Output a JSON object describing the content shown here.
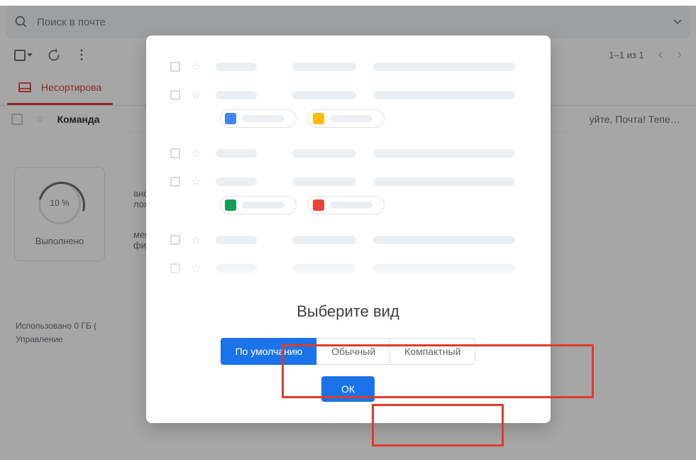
{
  "search": {
    "placeholder": "Поиск в почте"
  },
  "toolbar": {
    "count": "1–1 из 1"
  },
  "tabs": {
    "primary": "Несортирова"
  },
  "email": {
    "sender": "Команда",
    "preview": "уйте, Почта! Теперь у Вас ест…"
  },
  "progress": {
    "percent": "10 %",
    "label": "Выполнено"
  },
  "tips": {
    "line1a": "ановите",
    "line1b": "ложение Gmail",
    "line2a": "мените фото",
    "line2b": "филя"
  },
  "footer": {
    "line1": "Использовано 0 ГБ (",
    "line2": "Управление"
  },
  "dialog": {
    "title": "Выберите вид",
    "options": {
      "default": "По умолчанию",
      "normal": "Обычный",
      "compact": "Компактный"
    },
    "ok": "ОК"
  },
  "colors": {
    "docs": "#4285f4",
    "slides": "#fbbc04",
    "sheets": "#0f9d58",
    "image": "#ea4335"
  }
}
